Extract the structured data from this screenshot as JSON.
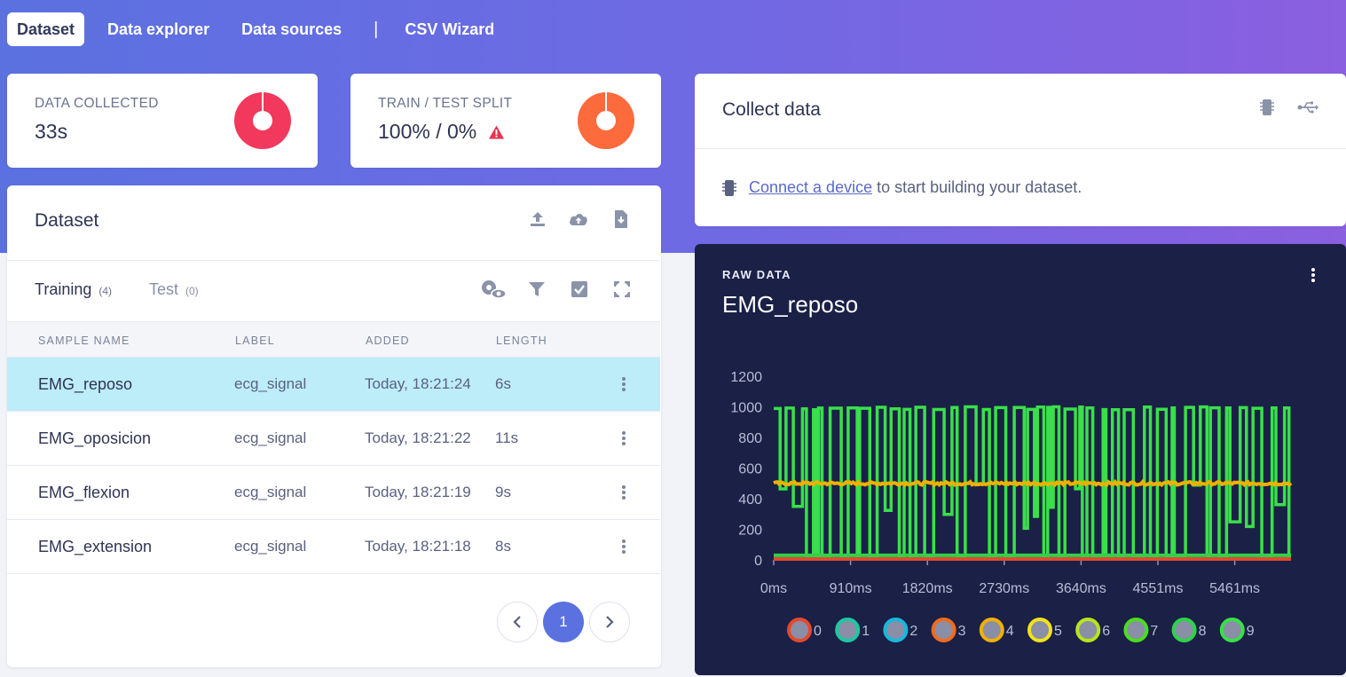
{
  "nav": {
    "tabs": [
      {
        "label": "Dataset",
        "active": true
      },
      {
        "label": "Data explorer"
      },
      {
        "label": "Data sources"
      },
      {
        "label": "CSV Wizard"
      }
    ]
  },
  "stats": {
    "data_collected": {
      "title": "DATA COLLECTED",
      "value": "33s",
      "color": "#f2385c"
    },
    "split": {
      "title": "TRAIN / TEST SPLIT",
      "value": "100% / 0%",
      "color": "#fd6a3c",
      "warning_icon": "warning-triangle-icon"
    }
  },
  "dataset": {
    "title": "Dataset",
    "actions": [
      "upload-icon",
      "cloud-upload-icon",
      "export-file-icon"
    ],
    "tabs": [
      {
        "label": "Training",
        "count": "(4)"
      },
      {
        "label": "Test",
        "count": "(0)"
      }
    ],
    "tools": [
      "settings-eye-icon",
      "filter-icon",
      "select-all-icon",
      "fullscreen-icon"
    ],
    "columns": [
      "SAMPLE NAME",
      "LABEL",
      "ADDED",
      "LENGTH"
    ],
    "rows": [
      {
        "name": "EMG_reposo",
        "label": "ecg_signal",
        "added": "Today, 18:21:24",
        "length": "6s",
        "selected": true
      },
      {
        "name": "EMG_oposicion",
        "label": "ecg_signal",
        "added": "Today, 18:21:22",
        "length": "11s"
      },
      {
        "name": "EMG_flexion",
        "label": "ecg_signal",
        "added": "Today, 18:21:19",
        "length": "9s"
      },
      {
        "name": "EMG_extension",
        "label": "ecg_signal",
        "added": "Today, 18:21:18",
        "length": "8s"
      }
    ],
    "pagination": {
      "prev": "‹",
      "current": "1",
      "next": "›"
    }
  },
  "collect": {
    "title": "Collect data",
    "icons": [
      "device-chip-icon",
      "usb-icon"
    ],
    "link_text": "Connect a device",
    "message": " to start building your dataset."
  },
  "raw_data": {
    "label": "RAW DATA",
    "title": "EMG_reposo",
    "chart_data": {
      "type": "line",
      "ylim": [
        0,
        1200
      ],
      "y_ticks": [
        "0",
        "200",
        "400",
        "600",
        "800",
        "1000",
        "1200"
      ],
      "x_ticks": [
        "0ms",
        "910ms",
        "1820ms",
        "2730ms",
        "3640ms",
        "4551ms",
        "5461ms"
      ],
      "x_range_ms": [
        0,
        6000
      ],
      "series": [
        {
          "name": "0",
          "color": "#e5482f",
          "values_summary": "constant ~0"
        },
        {
          "name": "1",
          "color": "#1fc7a0"
        },
        {
          "name": "2",
          "color": "#19b8dd"
        },
        {
          "name": "3",
          "color": "#f06b1d"
        },
        {
          "name": "4",
          "color": "#f0b000",
          "values_summary": "constant ~500"
        },
        {
          "name": "5",
          "color": "#f2e21a"
        },
        {
          "name": "6",
          "color": "#b7e61a"
        },
        {
          "name": "7",
          "color": "#4ade1e"
        },
        {
          "name": "8",
          "color": "#2ed34a"
        },
        {
          "name": "9",
          "color": "#38e04a",
          "values_summary": "square wave 0–1000"
        }
      ]
    }
  }
}
